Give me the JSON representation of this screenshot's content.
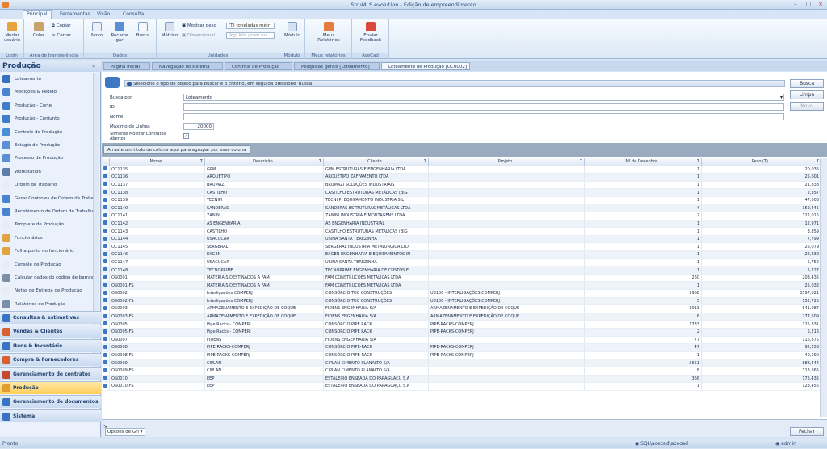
{
  "window": {
    "title": "StruMLS evolution - Edição de empreendimento"
  },
  "menu": [
    "Principal",
    "Ferramentas",
    "Visão",
    "Consulta"
  ],
  "ribbon": {
    "login_btn": "Mudar usuário",
    "login_group": "Login",
    "paste": "Colar",
    "copy": "Copiar",
    "cut": "Cortar",
    "clip_group": "Área de transferência",
    "new": "Novo",
    "refresh": "Recarre gar",
    "search": "Busca",
    "data_group": "Dados",
    "metric": "Métrico",
    "show_weight": "Mostrar peso",
    "dim_unit": "Dimensional",
    "weight_combo": "(T) toneladas métr",
    "weight_combo2": "(kg) kilo gram ou",
    "units_group": "Unidades",
    "module": "Módulo",
    "module_group": "Módulo",
    "reports": "Meus Relatórios",
    "reports_group": "Meus relatórios",
    "feedback": "Enviar Feedback",
    "acecad_group": "AceCad"
  },
  "doc_tabs": [
    "Página Inicial",
    "Navegação do sistema",
    "Controle de Produção",
    "Pesquisas gerais [Loteamento]",
    "Loteamento de Produção [OC0002]"
  ],
  "nav": {
    "title": "Produção",
    "items": [
      "Loteamento",
      "Medições & Pedido",
      "Produção - Corte",
      "Produção - Conjunto",
      "Controle de Produção",
      "Estágio de Produção",
      "Processo de Produção",
      "Workstation",
      "Ordem de Trabalho",
      "Gerar Controles de Ordem de Trabal...",
      "Recebimento de Ordem de Trabalho",
      "Template de Produção",
      "Funcionários",
      "Folha ponto do funcionário",
      "Console de Produção",
      "Calcular dados do código de barras",
      "Notas de Entrega de Produção",
      "Relatórios de Produção"
    ],
    "sections": [
      "Consultas & estimativas",
      "Vendas & Clientes",
      "Itens & Inventário",
      "Compra & Fornecedores",
      "Gerenciamento de contratos",
      "Produção",
      "Gerenciamento de documentos",
      "Sistema"
    ]
  },
  "search": {
    "info": "Selecione o tipo de objeto para buscar e o critério, em seguida pressione 'Busca'",
    "busca_por_label": "Busca por",
    "busca_por_value": "Loteamento",
    "id_label": "ID",
    "nome_label": "Nome",
    "max_label": "Máximo de Linhas",
    "max_value": "20000",
    "abertos_label": "Somente Mostrar Contratos Abertos",
    "group_hint": "Arraste um título de coluna aqui para agrupar por essa coluna",
    "btn_busca": "Busca",
    "btn_limpa": "Limpa",
    "btn_novo": "Novo"
  },
  "grid": {
    "columns": [
      "Nome",
      "Descrição",
      "Cliente",
      "Projeto",
      "Nº de Desenhos",
      "Peso (T)"
    ],
    "rows": [
      [
        "OC1135",
        "GPM",
        "GPM ESTRUTURAS E ENGENHARIA LTDA",
        "",
        "1",
        "20,035"
      ],
      [
        "OC1136",
        "ARQUETIPO",
        "ARQUETIPO ZAFFAMENTO LTDA",
        "",
        "1",
        "25,601"
      ],
      [
        "OC1137",
        "BRUMAZI",
        "BRUMAZI SOLUÇÕES INDUSTRIAIS",
        "",
        "1",
        "21,833"
      ],
      [
        "OC1138",
        "CASTILHO",
        "CASTILHO ESTRUTURAS METÁLICAS (BIG",
        "",
        "1",
        "2,357"
      ],
      [
        "OC1139",
        "TECNIPI",
        "TECNI PI EQUIPAMENTO INDUSTRIAIS L",
        "",
        "1",
        "47,003"
      ],
      [
        "OC1140",
        "SANDERAS",
        "SANDERAS ESTRUTURAS METÁLICAS LTDA",
        "",
        "4",
        "359,445"
      ],
      [
        "OC1141",
        "ZANINI",
        "ZANINI INDUSTRIA E MONTAGENS LTDA",
        "",
        "2",
        "322,015"
      ],
      [
        "OC1142",
        "AS ENGENHARIA",
        "AS ENGENHARIA INDUSTRIAL",
        "",
        "1",
        "12,971"
      ],
      [
        "OC1143",
        "CASTILHO",
        "CASTILHO ESTRUTURAS METÁLICAS (BIG",
        "",
        "1",
        "3,359"
      ],
      [
        "OC1144",
        "USACUCAR",
        "USINA SANTA TEREZINHA",
        "",
        "1",
        "7,799"
      ],
      [
        "OC1145",
        "SERGERAL",
        "SERGERAL INDUSTRIA METALURGICA LTD",
        "",
        "1",
        "25,079"
      ],
      [
        "OC1146",
        "EXGEN",
        "EXGEN ENGENHARIA E EQUIPAMENTOS IN",
        "",
        "1",
        "22,839"
      ],
      [
        "OC1147",
        "USACUCAR",
        "USINA SANTA TEREZINHA",
        "",
        "1",
        "5,752"
      ],
      [
        "OC1148",
        "TECNOPRIME",
        "TECNOPRIME ENGENHARIA DE CUSTOS E",
        "",
        "1",
        "5,227"
      ],
      [
        "OS0001",
        "MATERIAIS DESTINADOS A FAM",
        "FAM CONSTRUÇÕES METÁLICAS LTDA",
        "",
        "260",
        "203,435"
      ],
      [
        "OS0001-FS",
        "MATERIAIS DESTINADOS A FAM",
        "FAM CONSTRUÇÕES METÁLICAS LTDA",
        "",
        "1",
        "25,032"
      ],
      [
        "OS0002",
        "Interligações COMPERJ",
        "CONSÓRCIO TUC CONSTRUÇÕES",
        "U6100 - INTERLIGAÇÕES COMPERJ",
        "9968",
        "3597,021"
      ],
      [
        "OS0002-FS",
        "Interligações COMPERJ",
        "CONSÓRCIO TUC CONSTRUÇÕES",
        "U6100 - INTERLIGAÇÕES COMPERJ",
        "5",
        "152,725"
      ],
      [
        "OS0003",
        "ARMAZENAMENTO E EXPEDIÇÃO DE COQUE",
        "FIDENS ENGENHARIA S/A",
        "ARMAZENAMENTO E EXPEDIÇÃO DE COQUE",
        "1013",
        "641,087"
      ],
      [
        "OS0003-FS",
        "ARMAZENAMENTO E EXPEDIÇÃO DE COQUE",
        "FIDENS ENGENHARIA S/A",
        "ARMAZENAMENTO E EXPEDIÇÃO DE COQUE",
        "6",
        "277,609"
      ],
      [
        "OS0005",
        "Pipe Racks - COMPERJ",
        "CONSÓRCIO PIPE RACK",
        "PIPE-RACKS-COMPERJ",
        "1733",
        "125,831"
      ],
      [
        "OS0005-FS",
        "Pipe Racks - COMPERJ",
        "CONSÓRCIO PIPE RACK",
        "PIPE-RACKS-COMPERJ",
        "2",
        "5,216"
      ],
      [
        "OS0007",
        "FIDENS",
        "FIDENS ENGENHARIA S/A",
        "",
        "77",
        "116,875"
      ],
      [
        "OS0008",
        "PIPE-RACKS-COMPERJ",
        "CONSÓRCIO PIPE-RACK",
        "PIPE-RACKS-COMPERJ",
        "47",
        "92,253"
      ],
      [
        "OS0008-FS",
        "PIPE-RACKS-COMPERJ",
        "CONSÓRCIO PIPE-RACK",
        "PIPE-RACKS-COMPERJ",
        "1",
        "40,590"
      ],
      [
        "OS0009",
        "CIPLAN",
        "CIPLAN CIMENTO PLANALTO S/A",
        "",
        "3651",
        "888,444"
      ],
      [
        "OS0009-FS",
        "CIPLAN",
        "CIPLAN CIMENTO PLANALTO S/A",
        "",
        "8",
        "313,665"
      ],
      [
        "OS0010",
        "EEP",
        "ESTALEIRO ENSEADA DO PARAGUAÇU S.A",
        "",
        "366",
        "175,435"
      ],
      [
        "OS0010-FS",
        "EEP",
        "ESTALEIRO ENSEADA DO PARAGUAÇU S.A",
        "",
        "1",
        "123,456"
      ]
    ]
  },
  "bottom": {
    "options": "Opções de Gri",
    "close": "Fechar"
  },
  "status": {
    "left": "Pronto",
    "server": "SQL\\acecad\\acecad",
    "user": "admin"
  },
  "colors": {
    "accent": "#2f5b94",
    "nav_active": "#ffcf5a",
    "ribbon_bg": "#dbe8f6"
  }
}
